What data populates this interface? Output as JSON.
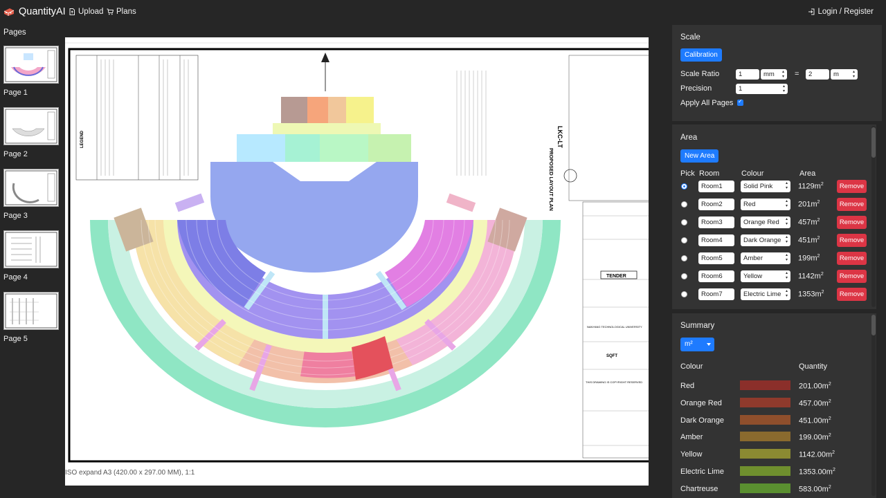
{
  "app": {
    "title": "QuantityAI"
  },
  "nav": {
    "upload": "Upload",
    "plans": "Plans",
    "login": "Login / Register"
  },
  "pages": {
    "title": "Pages",
    "items": [
      {
        "label": "Page 1"
      },
      {
        "label": "Page 2"
      },
      {
        "label": "Page 3"
      },
      {
        "label": "Page 4"
      },
      {
        "label": "Page 5"
      }
    ]
  },
  "drawing": {
    "caption": "ISO expand A3 (420.00 x 297.00 MM), 1:1",
    "title": "LKC-LT",
    "subtitle": "PROPOSED LAYOUT PLAN",
    "tender": "TENDER",
    "client": "NANYANG TECHNOLOGICAL UNIVERSITY",
    "architect_logo": "SQFT",
    "copyright": "THIS DRAWING IS COPYRIGHT RESERVED",
    "legend": "LEGEND"
  },
  "scale": {
    "title": "Scale",
    "calibration_label": "Calibration",
    "ratio_label": "Scale Ratio",
    "ratio_left_value": "1",
    "ratio_left_unit": "mm",
    "equals": "=",
    "ratio_right_value": "2",
    "ratio_right_unit": "m",
    "precision_label": "Precision",
    "precision_value": "1",
    "apply_all_label": "Apply All Pages",
    "apply_all_checked": true
  },
  "area": {
    "title": "Area",
    "new_area_label": "New Area",
    "headers": {
      "pick": "Pick",
      "room": "Room",
      "colour": "Colour",
      "area": "Area"
    },
    "remove_label": "Remove",
    "unit": "m",
    "unit_sup": "2",
    "rows": [
      {
        "room": "Room1",
        "colour": "Solid Pink",
        "area": "1129",
        "selected": true
      },
      {
        "room": "Room2",
        "colour": "Red",
        "area": "201",
        "selected": false
      },
      {
        "room": "Room3",
        "colour": "Orange Red",
        "area": "457",
        "selected": false
      },
      {
        "room": "Room4",
        "colour": "Dark Orange",
        "area": "451",
        "selected": false
      },
      {
        "room": "Room5",
        "colour": "Amber",
        "area": "199",
        "selected": false
      },
      {
        "room": "Room6",
        "colour": "Yellow",
        "area": "1142",
        "selected": false
      },
      {
        "room": "Room7",
        "colour": "Electric Lime",
        "area": "1353",
        "selected": false
      }
    ]
  },
  "summary": {
    "title": "Summary",
    "unit_select": "m²",
    "headers": {
      "colour": "Colour",
      "quantity": "Quantity"
    },
    "unit": "m",
    "unit_sup": "2",
    "rows": [
      {
        "colour": "Red",
        "quantity": "201.00",
        "swatch": "#8b2f2a"
      },
      {
        "colour": "Orange Red",
        "quantity": "457.00",
        "swatch": "#8f3a2c"
      },
      {
        "colour": "Dark Orange",
        "quantity": "451.00",
        "swatch": "#8f4f2c"
      },
      {
        "colour": "Amber",
        "quantity": "199.00",
        "swatch": "#8a6a2e"
      },
      {
        "colour": "Yellow",
        "quantity": "1142.00",
        "swatch": "#8b8a32"
      },
      {
        "colour": "Electric Lime",
        "quantity": "1353.00",
        "swatch": "#6f8f2e"
      },
      {
        "colour": "Chartreuse",
        "quantity": "583.00",
        "swatch": "#5a8f30"
      }
    ]
  },
  "colors": {
    "accent": "#1e7bff",
    "danger": "#dc3545",
    "background": "#262626",
    "panel": "#333333"
  }
}
